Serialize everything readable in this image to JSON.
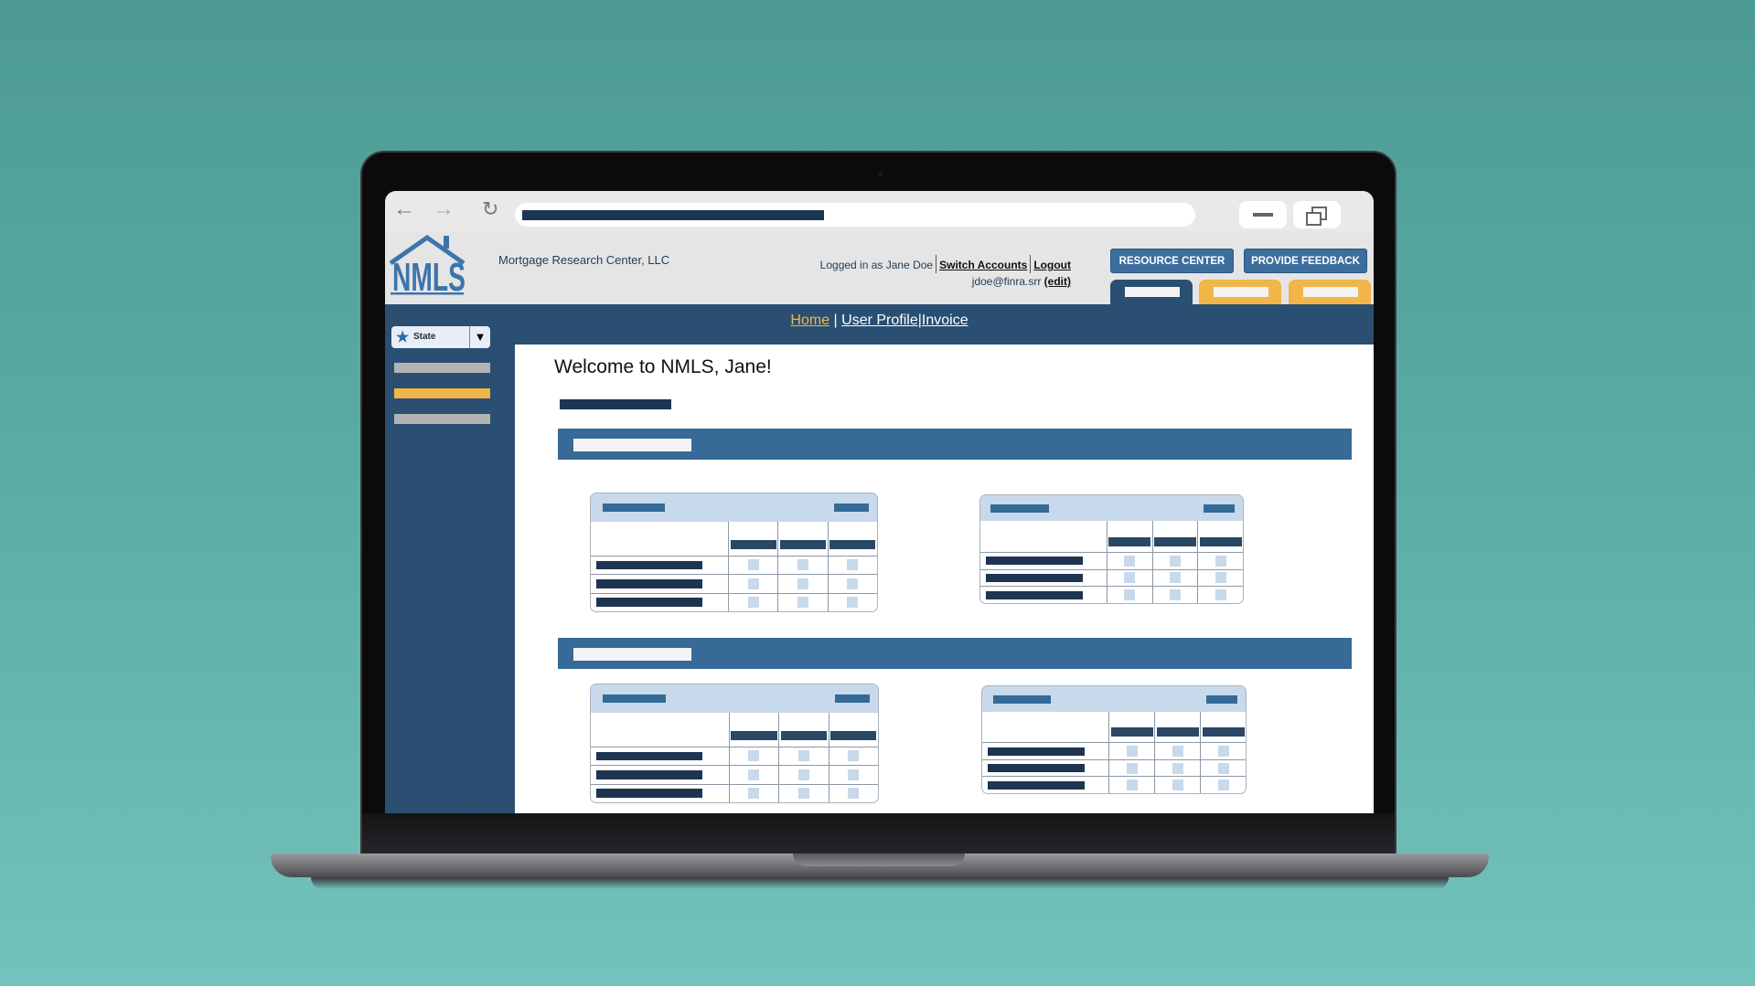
{
  "header": {
    "company": "Mortgage Research Center, LLC",
    "logged_in": "Logged in as Jane Doe",
    "switch_accounts": "Switch Accounts",
    "logout": "Logout",
    "email": "jdoe@finra.srr",
    "edit": "(edit)",
    "resource_center": "RESOURCE CENTER",
    "provide_feedback": "PROVIDE FEEDBACK",
    "logo_text": "NMLS"
  },
  "nav": {
    "links": [
      "Home",
      "User Profile",
      "Invoice"
    ],
    "separator": "|",
    "active": "Home"
  },
  "sidebar": {
    "state_label": "State",
    "icons": {
      "state": "star-icon",
      "dropdown": "triangle-down-icon"
    }
  },
  "content": {
    "welcome": "Welcome to NMLS, Jane!"
  },
  "browser": {
    "icons": [
      "back-arrow-icon",
      "forward-arrow-icon",
      "reload-icon",
      "minimize-icon",
      "restore-icon"
    ]
  },
  "colors": {
    "navy": "#2a4f72",
    "accent_orange": "#f2b54a",
    "button_blue": "#3d6d9c",
    "section_blue": "#376a96",
    "light_blue": "#c7d9ea"
  }
}
